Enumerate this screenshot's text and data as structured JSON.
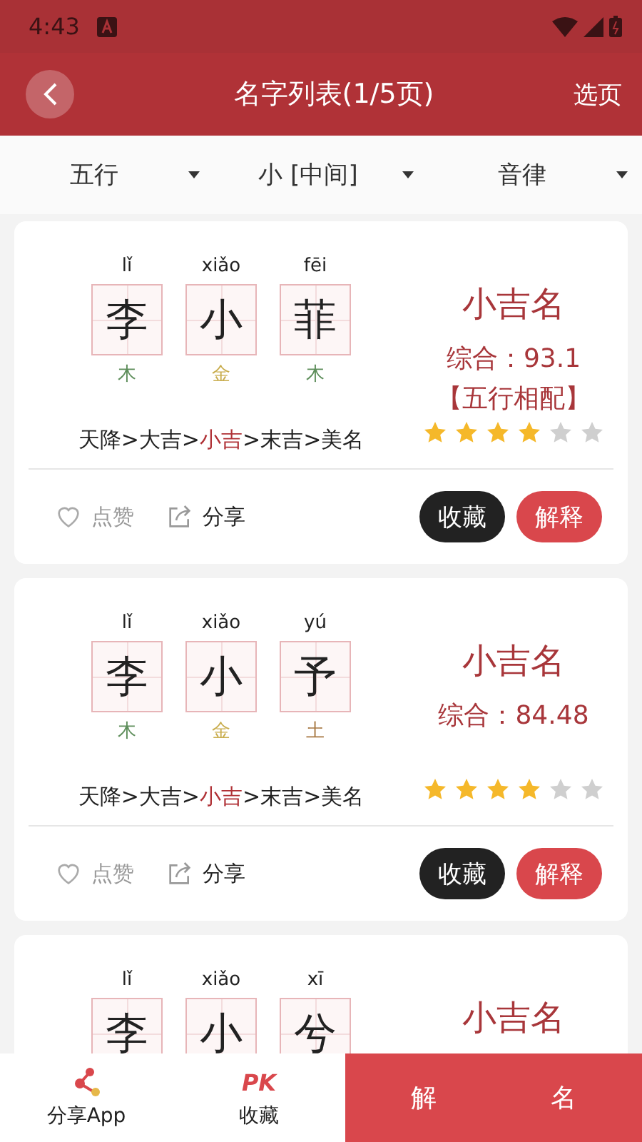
{
  "status_bar": {
    "time": "4:43"
  },
  "toolbar": {
    "title": "名字列表(1/5页)",
    "action": "选页"
  },
  "filters": [
    {
      "label": "五行"
    },
    {
      "label": "小 [中间]"
    },
    {
      "label": "音律"
    }
  ],
  "names": [
    {
      "chars": [
        {
          "pinyin": "lǐ",
          "char": "李",
          "element": "木",
          "color": "#5f8f5c"
        },
        {
          "pinyin": "xiǎo",
          "char": "小",
          "element": "金",
          "color": "#c9ad4e"
        },
        {
          "pinyin": "fēi",
          "char": "菲",
          "element": "木",
          "color": "#5f8f5c"
        }
      ],
      "grade": "小吉名",
      "separator": ">",
      "score": "综合：93.1",
      "note": "【五行相配】",
      "scale": [
        {
          "label": "天降",
          "selected": false
        },
        {
          "label": "大吉",
          "selected": false
        },
        {
          "label": "小吉",
          "selected": true
        },
        {
          "label": "末吉",
          "selected": false
        },
        {
          "label": "美名",
          "selected": false
        }
      ],
      "stars": 4,
      "like": {
        "label": "点赞",
        "liked": false
      },
      "share": "分享",
      "collect": "收藏",
      "explain": "解释"
    },
    {
      "chars": [
        {
          "pinyin": "lǐ",
          "char": "李",
          "element": "木",
          "color": "#5f8f5c"
        },
        {
          "pinyin": "xiǎo",
          "char": "小",
          "element": "金",
          "color": "#c9ad4e"
        },
        {
          "pinyin": "yú",
          "char": "予",
          "element": "土",
          "color": "#a87a45"
        }
      ],
      "grade": "小吉名",
      "separator": ">",
      "score": "综合：84.48",
      "scale": [
        {
          "label": "天降",
          "selected": false
        },
        {
          "label": "大吉",
          "selected": false
        },
        {
          "label": "小吉",
          "selected": true
        },
        {
          "label": "末吉",
          "selected": false
        },
        {
          "label": "美名",
          "selected": false
        }
      ],
      "stars": 4,
      "like": {
        "label": "点赞",
        "liked": false
      },
      "share": "分享",
      "collect": "收藏",
      "explain": "解释"
    },
    {
      "chars": [
        {
          "pinyin": "lǐ",
          "char": "李"
        },
        {
          "pinyin": "xiǎo",
          "char": "小"
        },
        {
          "pinyin": "xī",
          "char": "兮"
        }
      ],
      "grade": "小吉名"
    }
  ],
  "bottom_bar": {
    "items": [
      {
        "kind": "share",
        "label": "分享App"
      },
      {
        "kind": "pk",
        "label": "收藏",
        "badge": "PK"
      }
    ],
    "button": [
      "解",
      "名"
    ]
  }
}
